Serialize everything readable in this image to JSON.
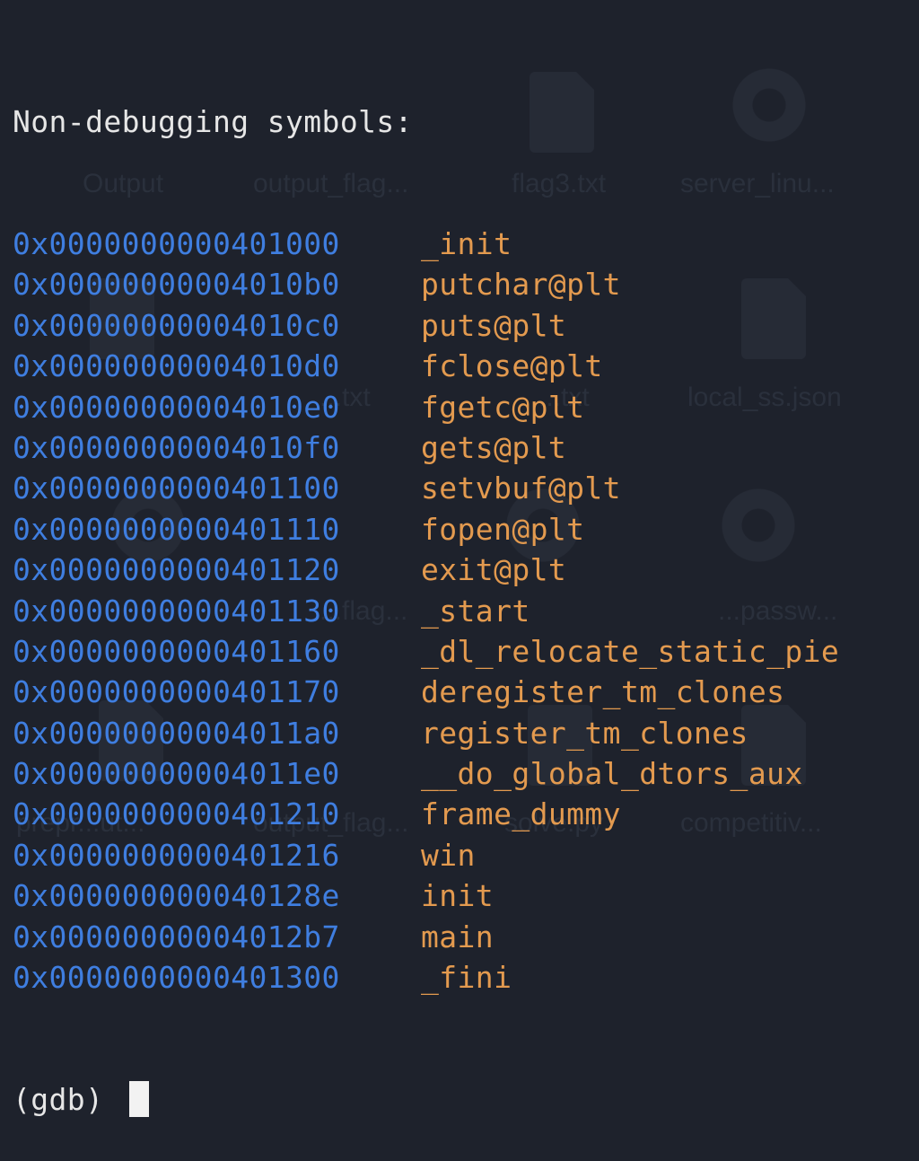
{
  "background": {
    "labels": [
      "Output",
      "output_flag...",
      "flag3.txt",
      "server_linu...",
      "local_ss.json",
      "...txt",
      "...txt",
      "...flag...",
      "...passw...",
      "prepr...ut...",
      "output_flag...",
      "solve.py",
      "competitiv..."
    ]
  },
  "terminal": {
    "header": "Non-debugging symbols:",
    "symbols": [
      {
        "address": "0x0000000000401000",
        "name": "_init"
      },
      {
        "address": "0x00000000004010b0",
        "name": "putchar@plt"
      },
      {
        "address": "0x00000000004010c0",
        "name": "puts@plt"
      },
      {
        "address": "0x00000000004010d0",
        "name": "fclose@plt"
      },
      {
        "address": "0x00000000004010e0",
        "name": "fgetc@plt"
      },
      {
        "address": "0x00000000004010f0",
        "name": "gets@plt"
      },
      {
        "address": "0x0000000000401100",
        "name": "setvbuf@plt"
      },
      {
        "address": "0x0000000000401110",
        "name": "fopen@plt"
      },
      {
        "address": "0x0000000000401120",
        "name": "exit@plt"
      },
      {
        "address": "0x0000000000401130",
        "name": "_start"
      },
      {
        "address": "0x0000000000401160",
        "name": "_dl_relocate_static_pie"
      },
      {
        "address": "0x0000000000401170",
        "name": "deregister_tm_clones"
      },
      {
        "address": "0x00000000004011a0",
        "name": "register_tm_clones"
      },
      {
        "address": "0x00000000004011e0",
        "name": "__do_global_dtors_aux"
      },
      {
        "address": "0x0000000000401210",
        "name": "frame_dummy"
      },
      {
        "address": "0x0000000000401216",
        "name": "win"
      },
      {
        "address": "0x000000000040128e",
        "name": "init"
      },
      {
        "address": "0x00000000004012b7",
        "name": "main"
      },
      {
        "address": "0x0000000000401300",
        "name": "_fini"
      }
    ],
    "prompt": "(gdb) "
  },
  "colors": {
    "background": "#1e222c",
    "address": "#3f7ee0",
    "symbol": "#e39a4f",
    "text": "#e6e6e6"
  }
}
